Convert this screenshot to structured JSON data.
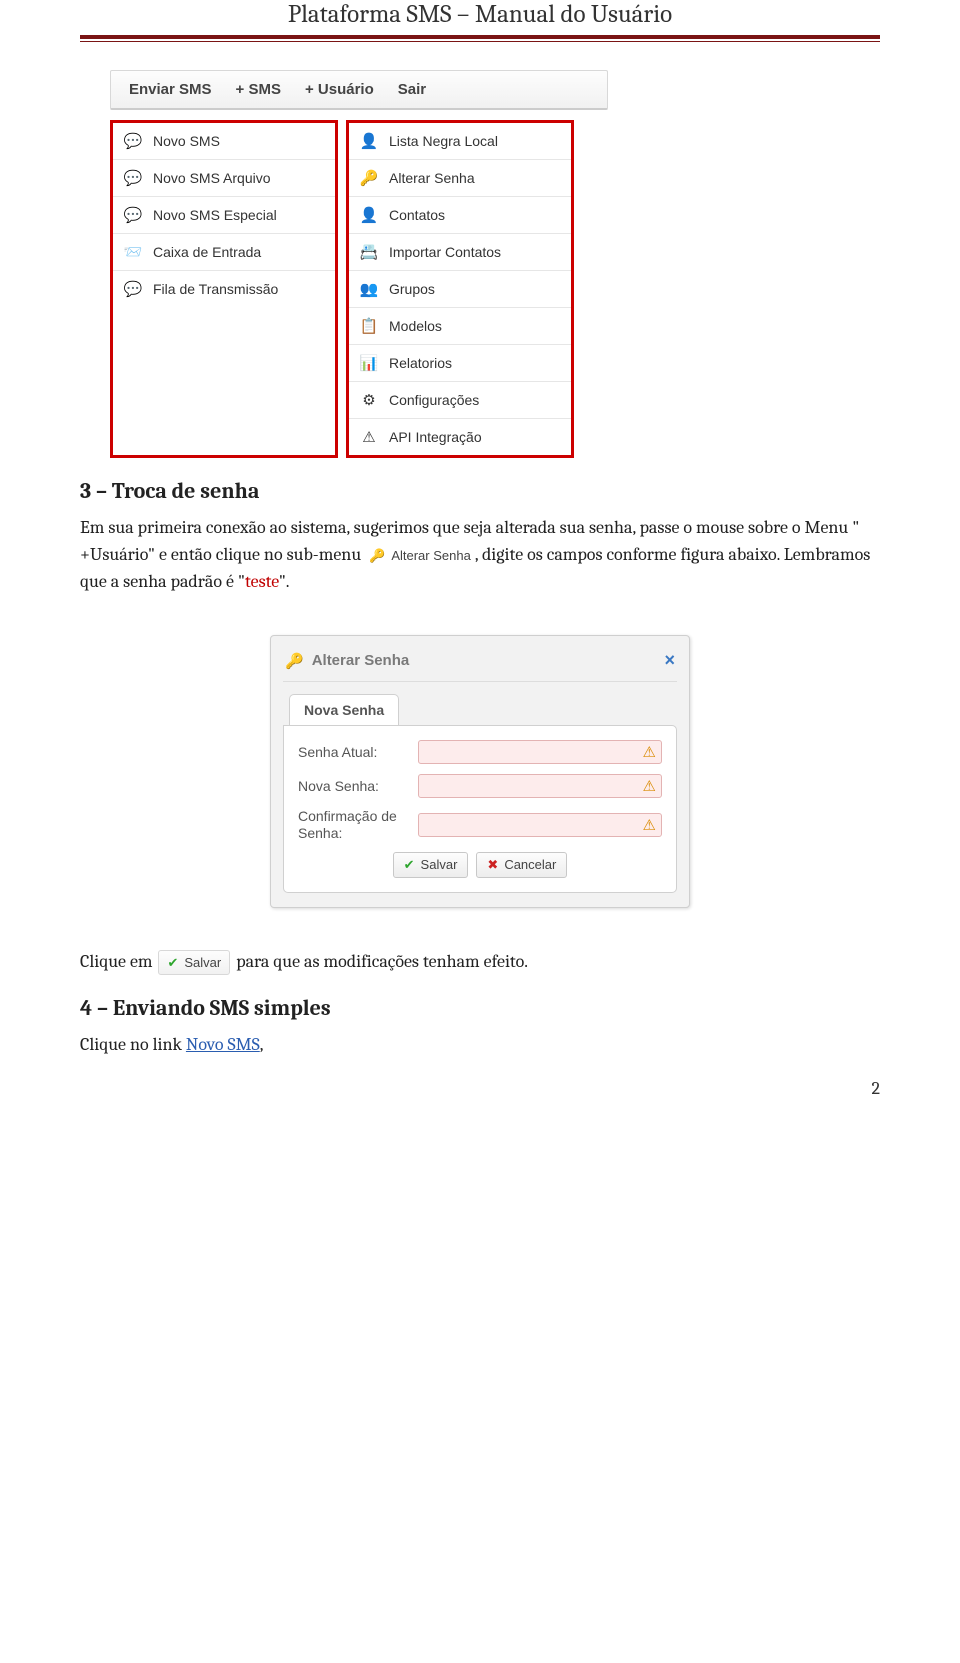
{
  "doc": {
    "header_title": "Plataforma SMS – Manual do Usuário",
    "page_number": "2"
  },
  "figure1": {
    "navbar": {
      "enviar_sms": "Enviar SMS",
      "plus_sms": "+   SMS",
      "plus_usuario": "+   Usuário",
      "sair": "Sair"
    },
    "left_menu": [
      {
        "icon": "💬",
        "label": "Novo SMS"
      },
      {
        "icon": "💬",
        "label": "Novo SMS Arquivo"
      },
      {
        "icon": "💬",
        "label": "Novo SMS Especial"
      },
      {
        "icon": "📨",
        "label": "Caixa de Entrada"
      },
      {
        "icon": "💬",
        "label": "Fila de Transmissão"
      }
    ],
    "right_menu": [
      {
        "icon": "👤",
        "label": "Lista Negra Local"
      },
      {
        "icon": "🔑",
        "label": "Alterar Senha"
      },
      {
        "icon": "👤",
        "label": "Contatos"
      },
      {
        "icon": "📇",
        "label": "Importar Contatos"
      },
      {
        "icon": "👥",
        "label": "Grupos"
      },
      {
        "icon": "📋",
        "label": "Modelos"
      },
      {
        "icon": "📊",
        "label": "Relatorios"
      },
      {
        "icon": "⚙",
        "label": "Configurações"
      },
      {
        "icon": "⚠",
        "label": "API Integração"
      }
    ]
  },
  "section3": {
    "heading": "3 – Troca de senha",
    "para_part1": "Em sua primeira conexão ao sistema, sugerimos que seja alterada sua senha, passe o mouse sobre o Menu \" +Usuário\" e então clique no sub-menu ",
    "inline_chip_icon": "🔑",
    "inline_chip_label": "Alterar Senha",
    "para_part2": ", digite os campos conforme figura abaixo. Lembramos que a senha padrão é \"",
    "teste_word": "teste",
    "para_part3": "\"."
  },
  "dialog": {
    "title_icon": "🔑",
    "title": "Alterar Senha",
    "close": "×",
    "tab_label": "Nova Senha",
    "rows": [
      {
        "label": "Senha Atual:"
      },
      {
        "label": "Nova Senha:"
      },
      {
        "label": "Confirmação de Senha:"
      }
    ],
    "buttons": {
      "save_icon": "✔",
      "save_label": "Salvar",
      "cancel_icon": "✖",
      "cancel_label": "Cancelar"
    }
  },
  "section3b": {
    "para_prefix": "Clique em ",
    "chip_icon": "✔",
    "chip_label": "Salvar",
    "para_suffix": " para que as modificações tenham efeito."
  },
  "section4": {
    "heading": "4 – Enviando SMS simples",
    "para_prefix": "Clique no link ",
    "link_text": "Novo SMS",
    "para_suffix": ","
  }
}
